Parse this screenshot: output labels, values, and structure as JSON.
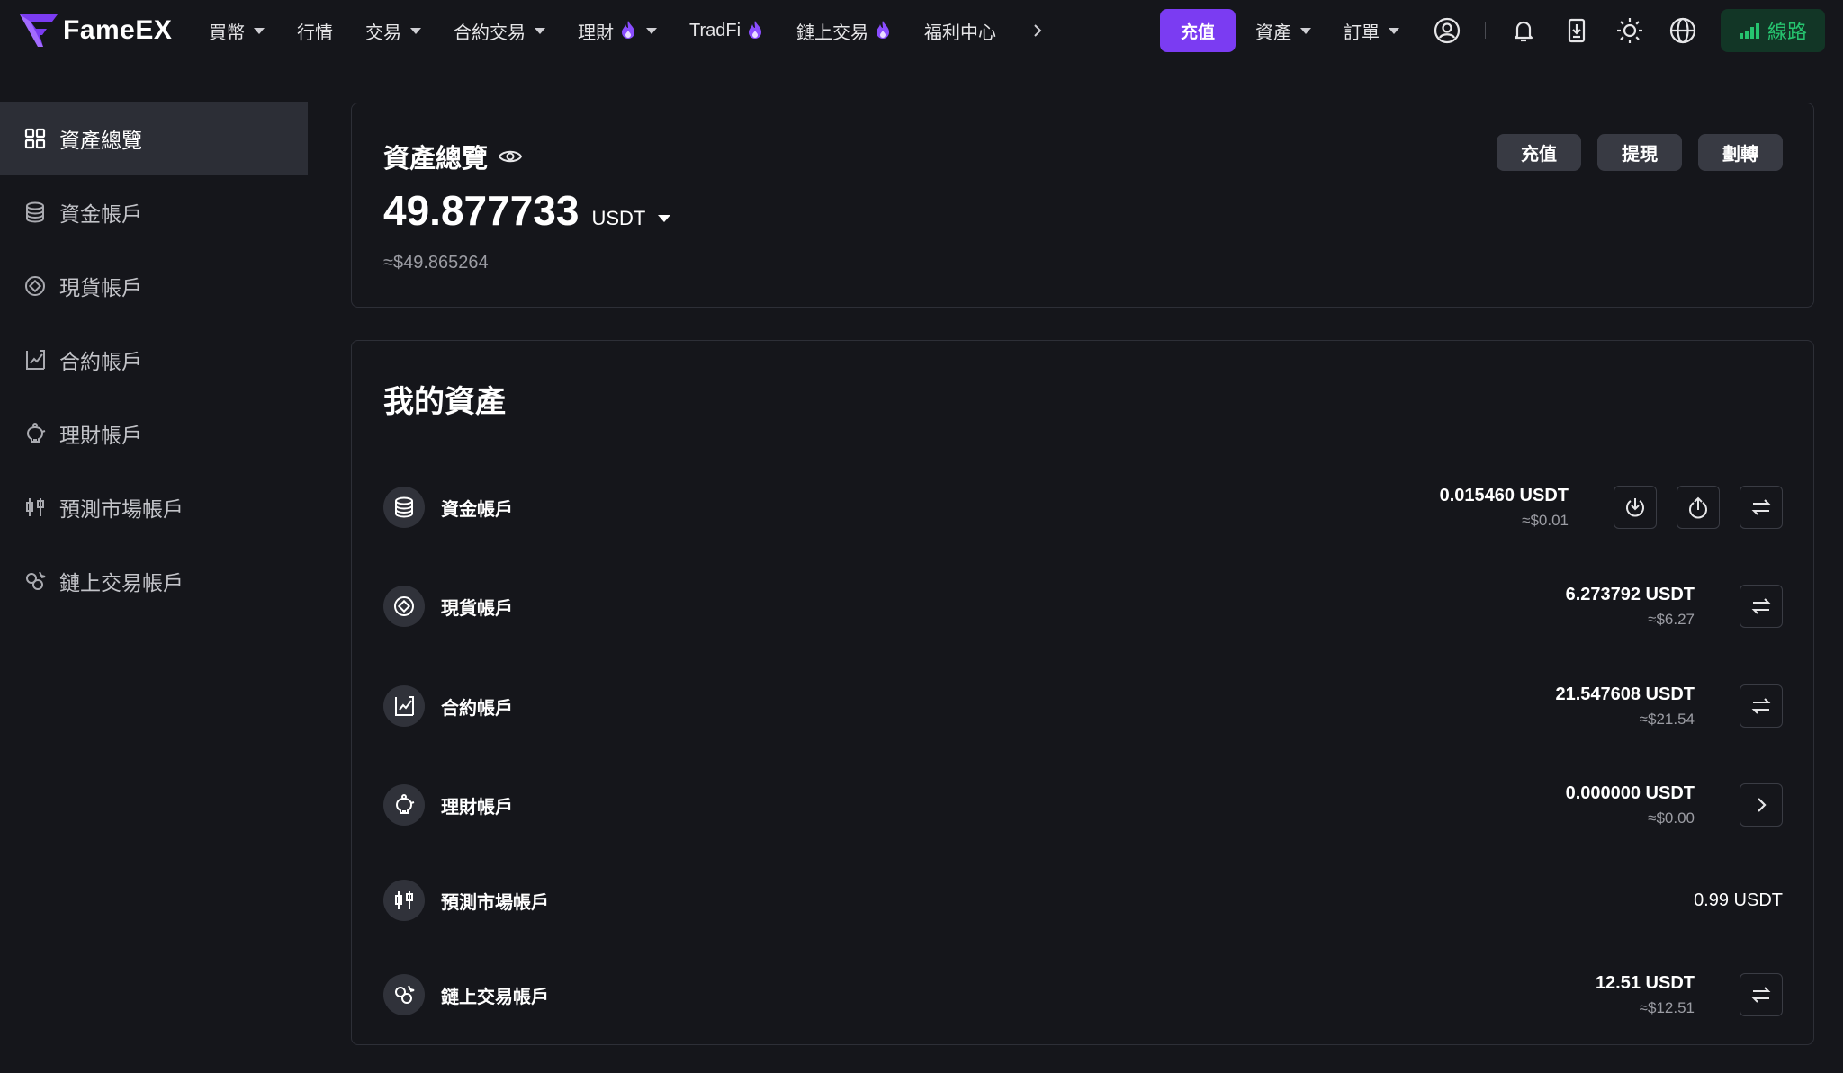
{
  "brand": {
    "name": "FameEX",
    "accent": "#7b3cf2",
    "route_color": "#26c46f"
  },
  "nav": {
    "items": [
      {
        "label": "買幣",
        "dropdown": true,
        "hot": false
      },
      {
        "label": "行情",
        "dropdown": false,
        "hot": false
      },
      {
        "label": "交易",
        "dropdown": true,
        "hot": false
      },
      {
        "label": "合約交易",
        "dropdown": true,
        "hot": false
      },
      {
        "label": "理財",
        "dropdown": true,
        "hot": true
      },
      {
        "label": "TradFi",
        "dropdown": false,
        "hot": true
      },
      {
        "label": "鏈上交易",
        "dropdown": false,
        "hot": true
      },
      {
        "label": "福利中心",
        "dropdown": false,
        "hot": false
      }
    ],
    "deposit_label": "充值",
    "assets_label": "資產",
    "orders_label": "訂單",
    "route_label": "線路",
    "icons": [
      "chevron-right-icon",
      "user-icon",
      "bell-icon",
      "download-icon",
      "sun-icon",
      "globe-icon",
      "signal-icon"
    ]
  },
  "sidebar": {
    "items": [
      {
        "label": "資產總覽",
        "icon": "grid-icon",
        "active": true
      },
      {
        "label": "資金帳戶",
        "icon": "database-icon",
        "active": false
      },
      {
        "label": "現貨帳戶",
        "icon": "spot-icon",
        "active": false
      },
      {
        "label": "合約帳戶",
        "icon": "chart-icon",
        "active": false
      },
      {
        "label": "理財帳戶",
        "icon": "piggy-icon",
        "active": false
      },
      {
        "label": "預測市場帳戶",
        "icon": "candles-icon",
        "active": false
      },
      {
        "label": "鏈上交易帳戶",
        "icon": "chain-icon",
        "active": false
      }
    ]
  },
  "overview": {
    "title": "資產總覽",
    "amount": "49.877733",
    "unit": "USDT",
    "approx": "≈$49.865264",
    "actions": [
      "充值",
      "提現",
      "劃轉"
    ]
  },
  "assets": {
    "title": "我的資產",
    "rows": [
      {
        "name": "資金帳戶",
        "value": "0.015460 USDT",
        "approx": "≈$0.01",
        "icon": "database-icon",
        "actions": [
          "deposit-icon",
          "withdraw-icon",
          "transfer-icon"
        ]
      },
      {
        "name": "現貨帳戶",
        "value": "6.273792 USDT",
        "approx": "≈$6.27",
        "icon": "spot-icon",
        "actions": [
          "transfer-icon"
        ]
      },
      {
        "name": "合約帳戶",
        "value": "21.547608 USDT",
        "approx": "≈$21.54",
        "icon": "chart-icon",
        "actions": [
          "transfer-icon"
        ]
      },
      {
        "name": "理財帳戶",
        "value": "0.000000 USDT",
        "approx": "≈$0.00",
        "icon": "piggy-icon",
        "actions": [
          "chevron-right-icon"
        ]
      },
      {
        "name": "預測市場帳戶",
        "value": "0.99 USDT",
        "approx": "",
        "icon": "candles-icon",
        "actions": []
      },
      {
        "name": "鏈上交易帳戶",
        "value": "12.51 USDT",
        "approx": "≈$12.51",
        "icon": "chain-icon",
        "actions": [
          "transfer-icon"
        ]
      }
    ]
  }
}
